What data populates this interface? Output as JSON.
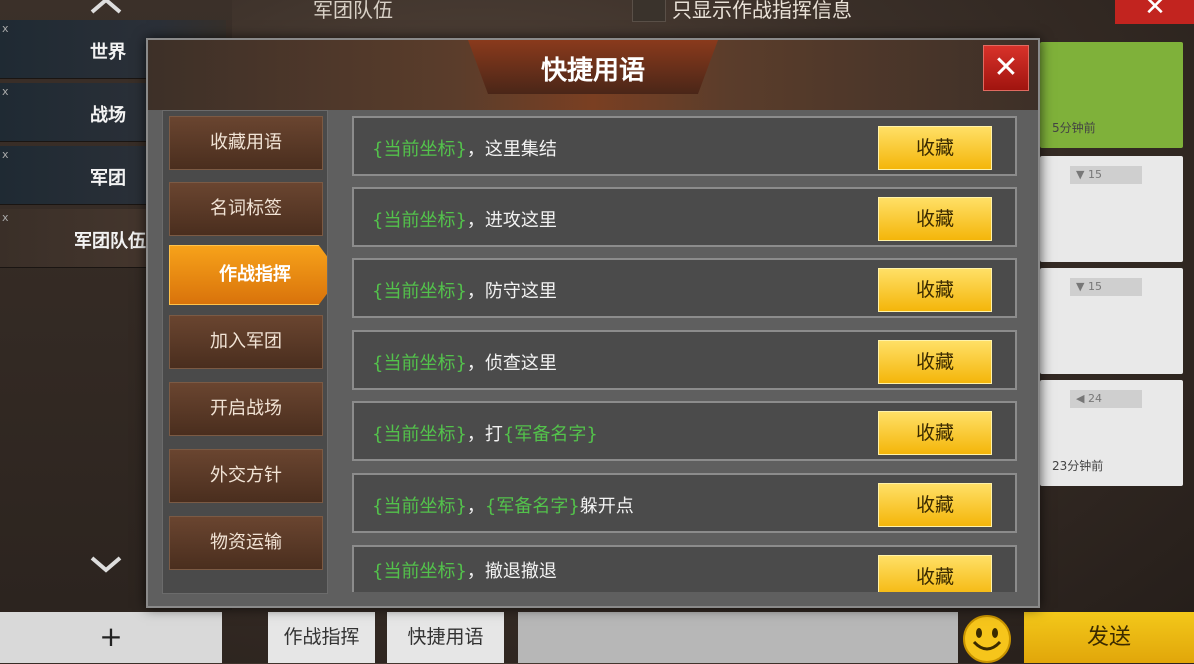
{
  "background": {
    "channels": [
      {
        "label": "世界"
      },
      {
        "label": "战场"
      },
      {
        "label": "军团"
      },
      {
        "label": "军团队伍"
      }
    ],
    "top_label": "军团队伍",
    "top_filter_label": "只显示作战指挥信息",
    "right_cards": [
      {
        "time": "5分钟前",
        "badge": ""
      },
      {
        "time": "",
        "badge": "15"
      },
      {
        "time": "",
        "badge": "15"
      },
      {
        "time": "23分钟前",
        "badge": "24"
      }
    ]
  },
  "dialog": {
    "title": "快捷用语",
    "categories": [
      {
        "label": "收藏用语"
      },
      {
        "label": "名词标签"
      },
      {
        "label": "作战指挥",
        "active": true
      },
      {
        "label": "加入军团"
      },
      {
        "label": "开启战场"
      },
      {
        "label": "外交方针"
      },
      {
        "label": "物资运输"
      }
    ],
    "fav_label": "收藏",
    "phrases": [
      {
        "token": "{当前坐标}",
        "sep": "，",
        "text": "这里集结",
        "token2": "",
        "tail": ""
      },
      {
        "token": "{当前坐标}",
        "sep": "，",
        "text": "进攻这里",
        "token2": "",
        "tail": ""
      },
      {
        "token": "{当前坐标}",
        "sep": "，",
        "text": "防守这里",
        "token2": "",
        "tail": ""
      },
      {
        "token": "{当前坐标}",
        "sep": "，",
        "text": "侦查这里",
        "token2": "",
        "tail": ""
      },
      {
        "token": "{当前坐标}",
        "sep": "，",
        "text": "打",
        "token2": "{军备名字}",
        "tail": ""
      },
      {
        "token": "{当前坐标}",
        "sep": "，",
        "text": "",
        "token2": "{军备名字}",
        "tail": "躲开点"
      },
      {
        "token": "{当前坐标}",
        "sep": "，",
        "text": "撤退撤退",
        "token2": "",
        "tail": ""
      }
    ]
  },
  "bottom": {
    "plus_label": "+",
    "tab1": "作战指挥",
    "tab2": "快捷用语",
    "send_label": "发送"
  },
  "colors": {
    "accent_orange": "#f39a17",
    "token_green": "#53c24b",
    "fav_yellow": "#f4b60a",
    "close_red": "#c8241e"
  }
}
